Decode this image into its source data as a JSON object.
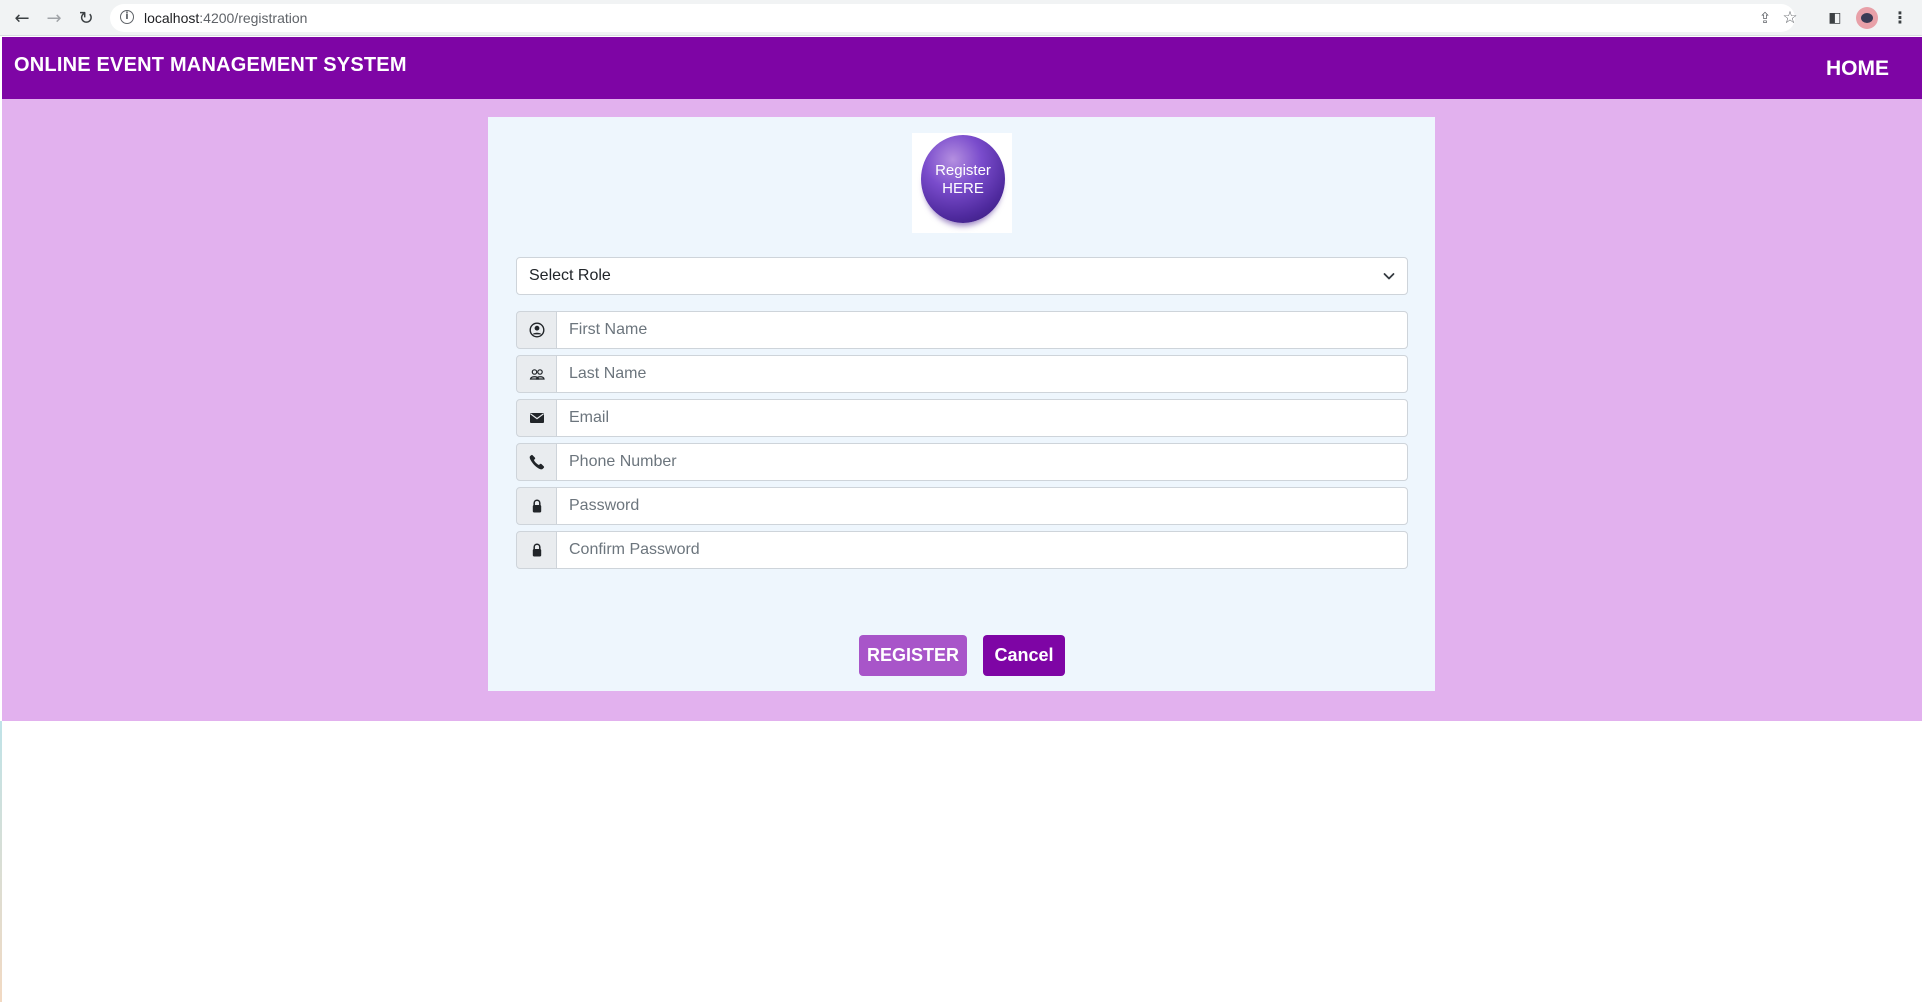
{
  "browser": {
    "url_host": "localhost",
    "url_rest": ":4200/registration"
  },
  "navbar": {
    "title": "ONLINE EVENT MANAGEMENT SYSTEM",
    "home_label": "HOME"
  },
  "form": {
    "logo_text_line1": "Register",
    "logo_text_line2": "HERE",
    "role_select": {
      "selected": "Select Role"
    },
    "fields": [
      {
        "placeholder": "First Name",
        "value": "",
        "icon": "person-circle-icon"
      },
      {
        "placeholder": "Last Name",
        "value": "",
        "icon": "people-icon"
      },
      {
        "placeholder": "Email",
        "value": "",
        "icon": "envelope-icon"
      },
      {
        "placeholder": "Phone Number",
        "value": "",
        "icon": "phone-icon"
      },
      {
        "placeholder": "Password",
        "value": "",
        "icon": "lock-icon"
      },
      {
        "placeholder": "Confirm Password",
        "value": "",
        "icon": "lock-icon"
      }
    ],
    "register_label": "REGISTER",
    "cancel_label": "Cancel"
  },
  "colors": {
    "navbar": "#7e05a5",
    "page_background": "#e2b1ee",
    "card_background": "#eef6fd",
    "register_button": "#a855c9",
    "cancel_button": "#7e05a5"
  }
}
